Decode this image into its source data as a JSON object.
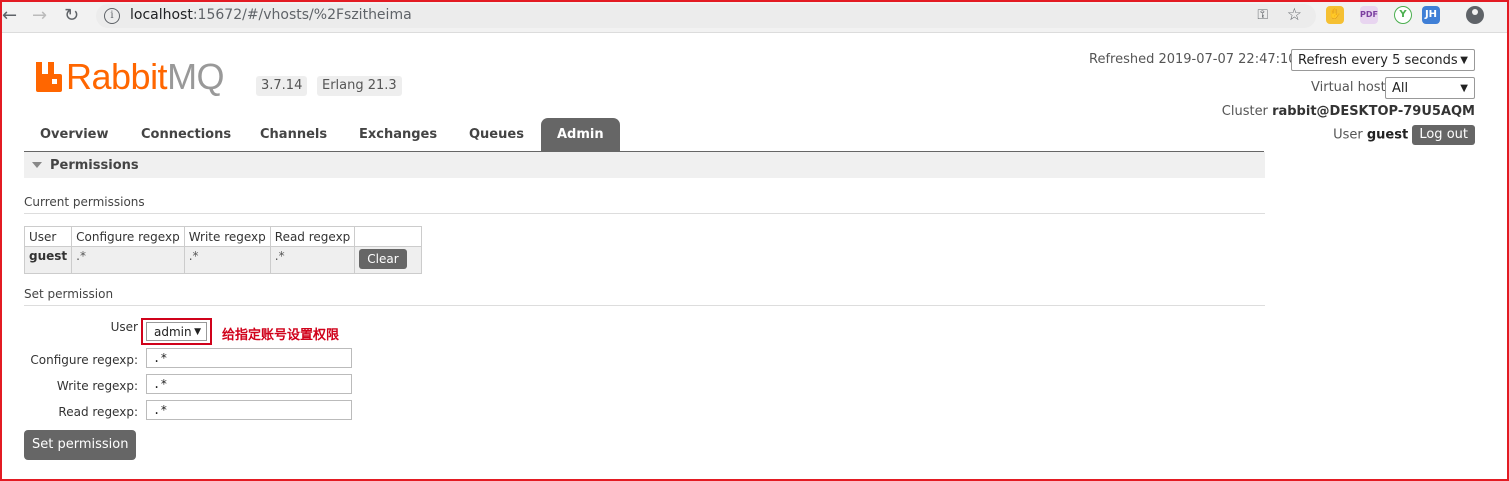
{
  "browser": {
    "url_host": "localhost",
    "url_path": ":15672/#/vhosts/%2Fszitheima",
    "back_icon": "arrow-left",
    "forward_icon": "arrow-right",
    "reload_icon": "reload",
    "extensions": [
      "hand-icon",
      "pdf-icon",
      "y-icon",
      "JH"
    ]
  },
  "header": {
    "logo_rabbit": "Rabbit",
    "logo_mq": "MQ",
    "version": "3.7.14",
    "erlang": "Erlang 21.3",
    "refreshed_label": "Refreshed 2019-07-07 22:47:10",
    "refresh_option": "Refresh every 5 seconds",
    "vhost_label": "Virtual host",
    "vhost_option": "All",
    "cluster_label": "Cluster",
    "cluster_value": "rabbit@DESKTOP-79U5AQM",
    "user_label": "User",
    "user_value": "guest",
    "logout": "Log out"
  },
  "tabs": [
    {
      "label": "Overview"
    },
    {
      "label": "Connections"
    },
    {
      "label": "Channels"
    },
    {
      "label": "Exchanges"
    },
    {
      "label": "Queues"
    },
    {
      "label": "Admin",
      "active": true
    }
  ],
  "section": {
    "title": "Permissions",
    "current_title": "Current permissions",
    "columns": [
      "User",
      "Configure regexp",
      "Write regexp",
      "Read regexp"
    ],
    "rows": [
      {
        "user": "guest",
        "configure": ".*",
        "write": ".*",
        "read": ".*",
        "action": "Clear"
      }
    ],
    "set_title": "Set permission"
  },
  "form": {
    "user_label": "User",
    "user_value": "admin",
    "configure_label": "Configure regexp:",
    "configure_value": ".*",
    "write_label": "Write regexp:",
    "write_value": ".*",
    "read_label": "Read regexp:",
    "read_value": ".*",
    "submit": "Set permission",
    "annotation": "给指定账号设置权限"
  },
  "colors": {
    "brand": "#ff6600",
    "tab_active": "#666666",
    "annotation": "#d0021b"
  }
}
